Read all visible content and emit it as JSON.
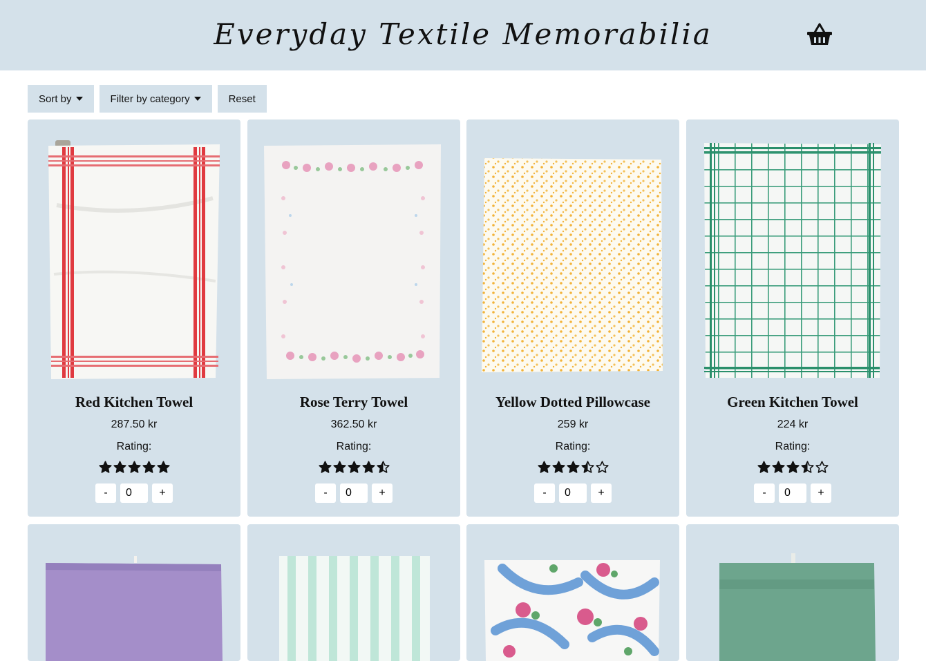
{
  "header": {
    "title": "Everyday Textile Memorabilia"
  },
  "controls": {
    "sort_label": "Sort by",
    "filter_label": "Filter by category",
    "reset_label": "Reset"
  },
  "rating_label": "Rating:",
  "products": [
    {
      "name": "Red Kitchen Towel",
      "price": "287.50 kr",
      "rating": 5,
      "quantity": "0",
      "icon": "red-striped-towel"
    },
    {
      "name": "Rose Terry Towel",
      "price": "362.50 kr",
      "rating": 4.5,
      "quantity": "0",
      "icon": "rose-border-towel"
    },
    {
      "name": "Yellow Dotted Pillowcase",
      "price": "259 kr",
      "rating": 3.5,
      "quantity": "0",
      "icon": "yellow-dotted-pillowcase"
    },
    {
      "name": "Green Kitchen Towel",
      "price": "224 kr",
      "rating": 3.5,
      "quantity": "0",
      "icon": "green-check-towel"
    },
    {
      "icon": "purple-terry-towel"
    },
    {
      "icon": "mint-striped-towel"
    },
    {
      "icon": "floral-print-cloth"
    },
    {
      "icon": "green-terry-towel"
    }
  ],
  "qty_controls": {
    "minus": "-",
    "plus": "+"
  },
  "colors": {
    "panel": "#d4e1ea",
    "text": "#111111"
  }
}
